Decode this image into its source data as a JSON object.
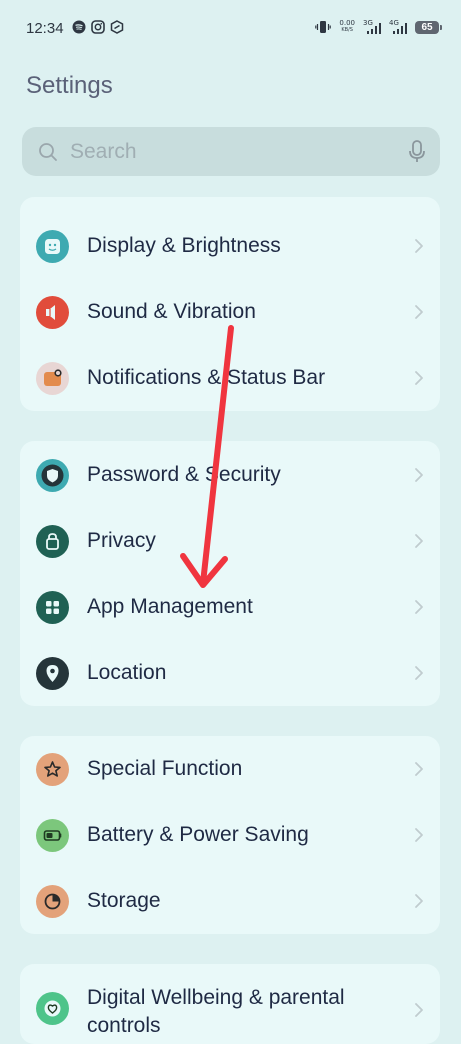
{
  "status_bar": {
    "time": "12:34",
    "net_speed_value": "0.00",
    "net_speed_unit": "KB/S",
    "signal1_label": "3G",
    "signal2_label": "4G",
    "battery": "65"
  },
  "header": {
    "title": "Settings"
  },
  "search": {
    "placeholder": "Search"
  },
  "groups": [
    {
      "items": [
        {
          "label": "Display & Brightness"
        },
        {
          "label": "Sound & Vibration"
        },
        {
          "label": "Notifications & Status Bar"
        }
      ]
    },
    {
      "items": [
        {
          "label": "Password & Security"
        },
        {
          "label": "Privacy"
        },
        {
          "label": "App Management"
        },
        {
          "label": "Location"
        }
      ]
    },
    {
      "items": [
        {
          "label": "Special Function"
        },
        {
          "label": "Battery & Power Saving"
        },
        {
          "label": "Storage"
        }
      ]
    },
    {
      "items": [
        {
          "label": "Digital Wellbeing & parental controls"
        }
      ]
    }
  ],
  "colors": {
    "background": "#ddf1f1",
    "card": "#e9f9f9",
    "annotation_arrow": "#f0353f"
  }
}
